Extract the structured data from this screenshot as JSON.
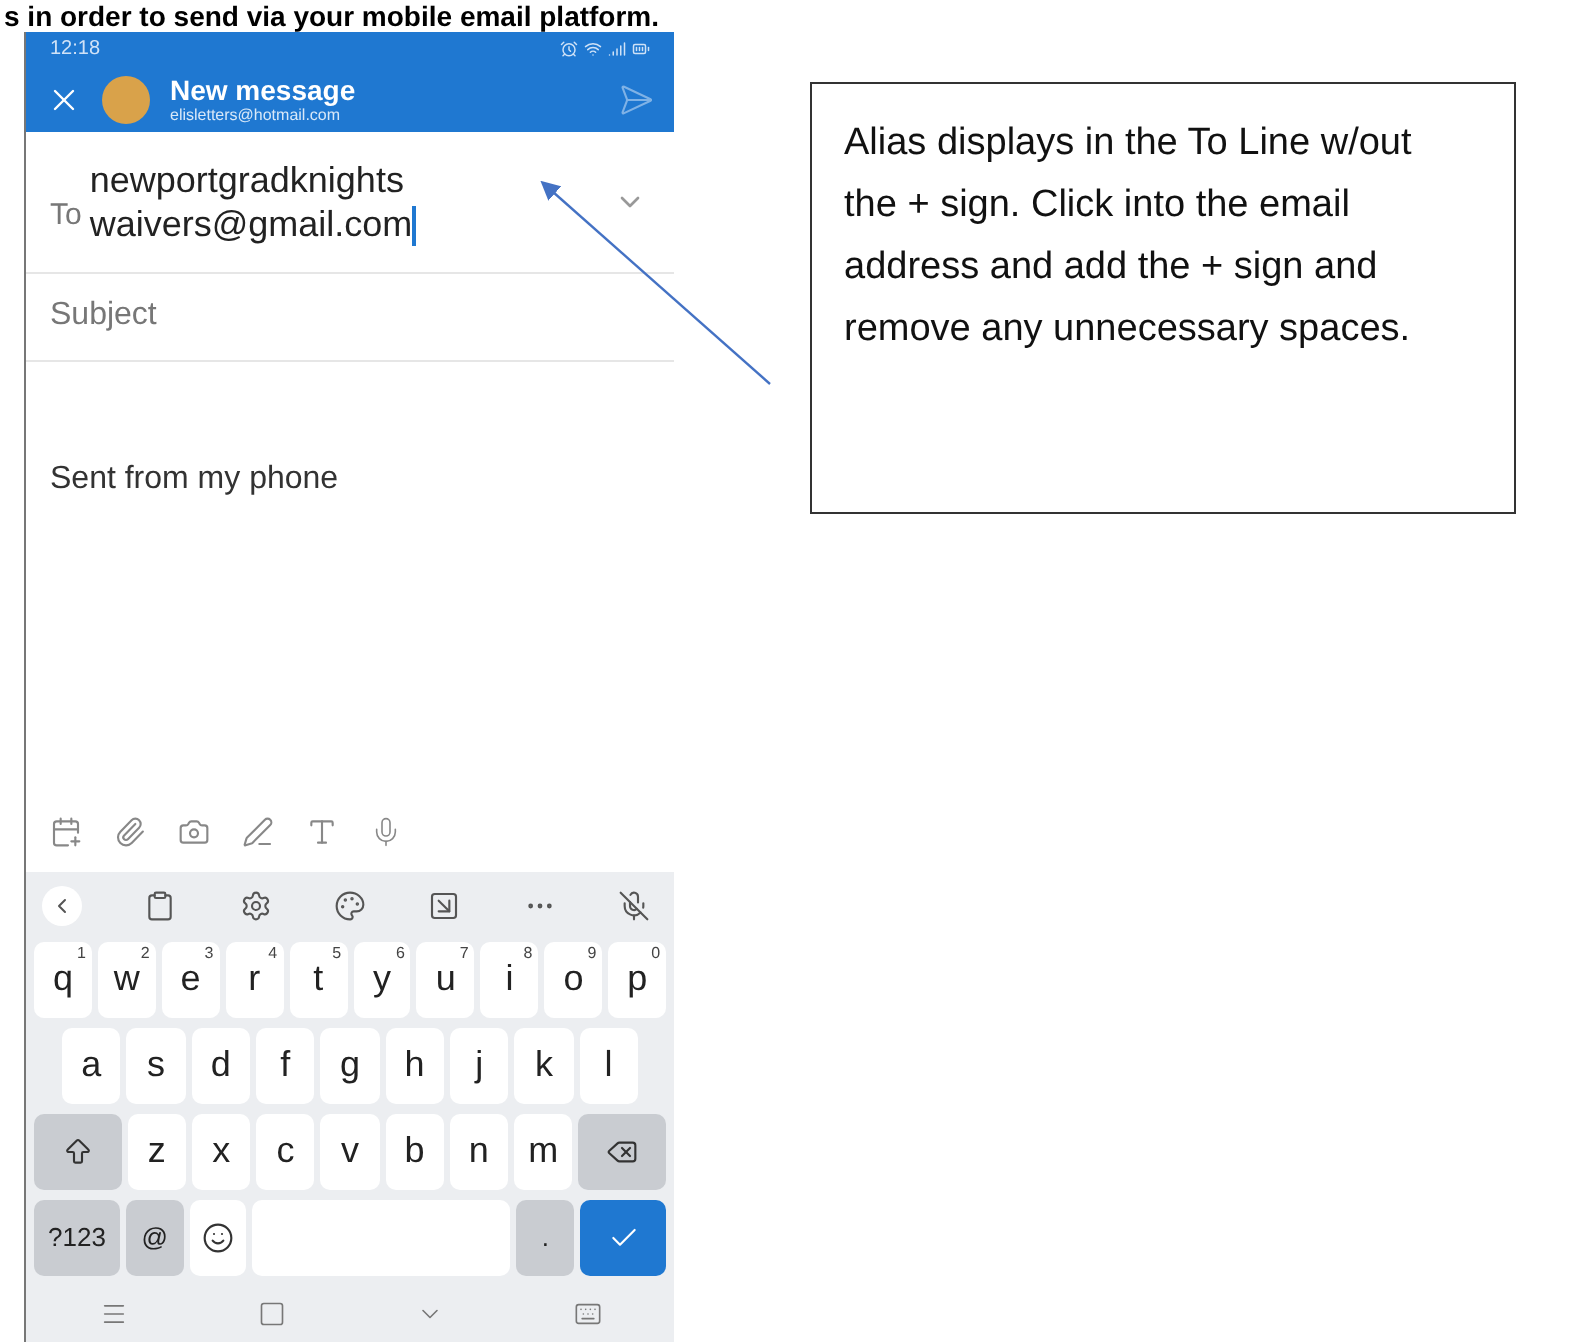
{
  "heading": "s in order to send via your mobile email platform.",
  "phone": {
    "status_bar": {
      "time": "12:18"
    },
    "header": {
      "title": "New message",
      "account": "elisletters@hotmail.com"
    },
    "to": {
      "label": "To",
      "value": "newportgradknights waivers@gmail.com"
    },
    "subject": {
      "placeholder": "Subject"
    },
    "body": "Sent from my phone",
    "keyboard": {
      "rows": [
        {
          "keys": [
            {
              "kind": "letter",
              "label": "q",
              "hint": "1"
            },
            {
              "kind": "letter",
              "label": "w",
              "hint": "2"
            },
            {
              "kind": "letter",
              "label": "e",
              "hint": "3"
            },
            {
              "kind": "letter",
              "label": "r",
              "hint": "4"
            },
            {
              "kind": "letter",
              "label": "t",
              "hint": "5"
            },
            {
              "kind": "letter",
              "label": "y",
              "hint": "6"
            },
            {
              "kind": "letter",
              "label": "u",
              "hint": "7"
            },
            {
              "kind": "letter",
              "label": "i",
              "hint": "8"
            },
            {
              "kind": "letter",
              "label": "o",
              "hint": "9"
            },
            {
              "kind": "letter",
              "label": "p",
              "hint": "0"
            }
          ]
        },
        {
          "keys": [
            {
              "kind": "letter",
              "label": "a"
            },
            {
              "kind": "letter",
              "label": "s"
            },
            {
              "kind": "letter",
              "label": "d"
            },
            {
              "kind": "letter",
              "label": "f"
            },
            {
              "kind": "letter",
              "label": "g"
            },
            {
              "kind": "letter",
              "label": "h"
            },
            {
              "kind": "letter",
              "label": "j"
            },
            {
              "kind": "letter",
              "label": "k"
            },
            {
              "kind": "letter",
              "label": "l"
            }
          ]
        },
        {
          "keys": [
            {
              "kind": "shift"
            },
            {
              "kind": "letter",
              "label": "z"
            },
            {
              "kind": "letter",
              "label": "x"
            },
            {
              "kind": "letter",
              "label": "c"
            },
            {
              "kind": "letter",
              "label": "v"
            },
            {
              "kind": "letter",
              "label": "b"
            },
            {
              "kind": "letter",
              "label": "n"
            },
            {
              "kind": "letter",
              "label": "m"
            },
            {
              "kind": "backspace"
            }
          ]
        },
        {
          "keys": [
            {
              "kind": "symbols",
              "label": "?123"
            },
            {
              "kind": "symbols",
              "label": "@"
            },
            {
              "kind": "emoji"
            },
            {
              "kind": "space"
            },
            {
              "kind": "symbols",
              "label": "."
            },
            {
              "kind": "enter"
            }
          ]
        }
      ]
    }
  },
  "callout": "Alias displays in the To Line w/out the + sign. Click into the email address and add the + sign and remove any unnecessary spaces."
}
